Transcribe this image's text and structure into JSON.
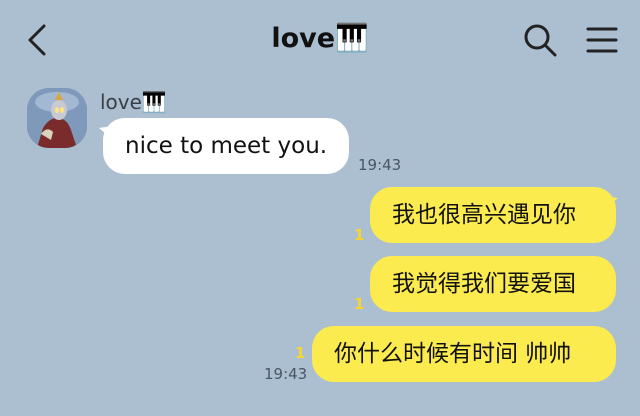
{
  "header": {
    "title": "love🎹",
    "back_icon": "chevron-left-icon",
    "search_icon": "search-icon",
    "menu_icon": "menu-icon"
  },
  "messages": [
    {
      "direction": "in",
      "sender": "love🎹",
      "text": "nice to meet you.",
      "time": "19:43"
    },
    {
      "direction": "out",
      "text": "我也很高兴遇见你",
      "unread": "1"
    },
    {
      "direction": "out",
      "text": "我觉得我们要爱国",
      "unread": "1"
    },
    {
      "direction": "out",
      "text": "你什么时候有时间 帅帅",
      "unread": "1",
      "time": "19:43"
    }
  ],
  "colors": {
    "background": "#abbfd1",
    "incoming_bubble": "#ffffff",
    "outgoing_bubble": "#fbeb4e",
    "unread_count": "#f7d531"
  }
}
